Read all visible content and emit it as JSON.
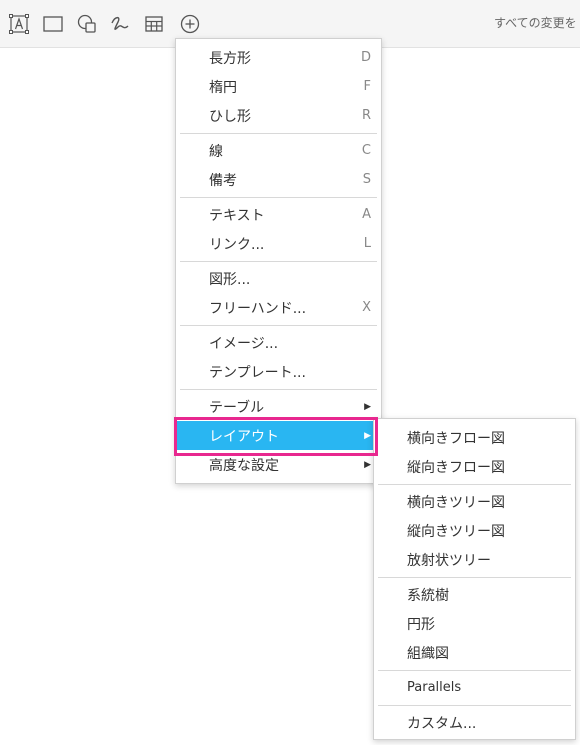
{
  "toolbar": {
    "tools": [
      {
        "icon": "text-tool-icon"
      },
      {
        "icon": "rectangle-icon"
      },
      {
        "icon": "shapes-icon"
      },
      {
        "icon": "freehand-icon"
      },
      {
        "icon": "table-icon"
      },
      {
        "icon": "insert-plus-icon"
      }
    ],
    "status_text": "すべての変更を"
  },
  "insert_menu": {
    "items": [
      {
        "label": "長方形",
        "shortcut": "D"
      },
      {
        "label": "楕円",
        "shortcut": "F"
      },
      {
        "label": "ひし形",
        "shortcut": "R"
      },
      {
        "label": "線",
        "shortcut": "C"
      },
      {
        "label": "備考",
        "shortcut": "S"
      },
      {
        "label": "テキスト",
        "shortcut": "A"
      },
      {
        "label": "リンク...",
        "shortcut": "L"
      },
      {
        "label": "図形..."
      },
      {
        "label": "フリーハンド...",
        "shortcut": "X"
      },
      {
        "label": "イメージ..."
      },
      {
        "label": "テンプレート..."
      },
      {
        "label": "テーブル",
        "submenu": true
      },
      {
        "label": "レイアウト",
        "submenu": true,
        "active": true
      },
      {
        "label": "高度な設定",
        "submenu": true
      }
    ]
  },
  "layout_submenu": {
    "items": [
      {
        "label": "横向きフロー図"
      },
      {
        "label": "縦向きフロー図"
      },
      {
        "label": "横向きツリー図"
      },
      {
        "label": "縦向きツリー図"
      },
      {
        "label": "放射状ツリー"
      },
      {
        "label": "系統樹"
      },
      {
        "label": "円形"
      },
      {
        "label": "組織図"
      },
      {
        "label": "Parallels"
      },
      {
        "label": "カスタム..."
      }
    ]
  },
  "colors": {
    "active_item": "#29b6f2",
    "highlight_box": "#e8288f"
  }
}
